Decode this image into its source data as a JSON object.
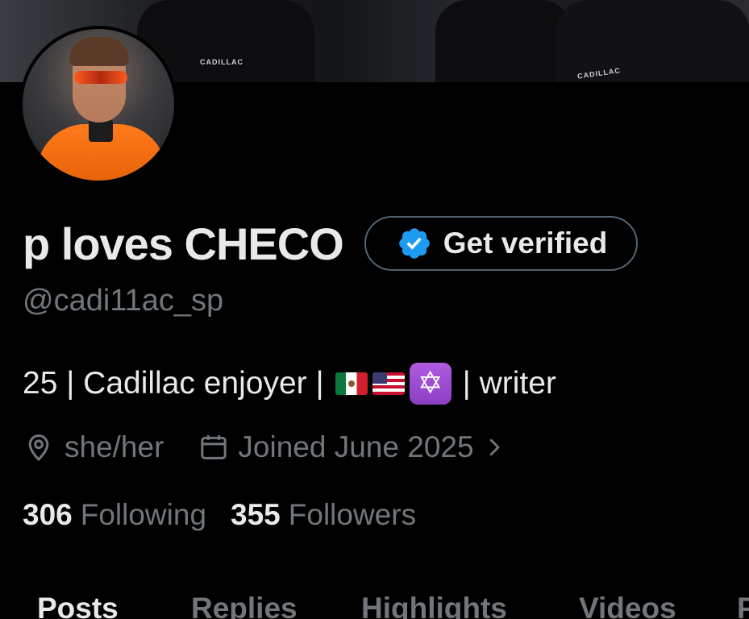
{
  "banner": {
    "emblem_left": "CADILLAC",
    "emblem_right": "CADILLAC"
  },
  "profile": {
    "display_name": "p loves CHECO",
    "verify_button_label": "Get verified",
    "handle": "@cadi11ac_sp",
    "bio": {
      "part1": "25 | Cadillac enjoyer |",
      "star_glyph": "✡",
      "part2": "| writer"
    },
    "pronouns": "she/her",
    "joined": "Joined June 2025"
  },
  "counts": {
    "following_num": "306",
    "following_label": "Following",
    "followers_num": "355",
    "followers_label": "Followers"
  },
  "tabs": [
    {
      "label": "Posts",
      "active": true
    },
    {
      "label": "Replies",
      "active": false
    },
    {
      "label": "Highlights",
      "active": false
    },
    {
      "label": "Videos",
      "active": false
    },
    {
      "label": "P",
      "active": false
    }
  ],
  "icons": {
    "verified_badge": "verified-badge-icon",
    "location": "location-icon",
    "calendar": "calendar-icon",
    "chevron": "chevron-right-icon",
    "flag_mexico": "flag-mexico-icon",
    "flag_usa": "flag-usa-icon",
    "star_of_david": "star-of-david-icon"
  },
  "colors": {
    "background": "#000000",
    "primary_text": "#e7e9ea",
    "secondary_text": "#71767b",
    "verified_blue": "#1d9bf0",
    "button_border": "#536471"
  }
}
